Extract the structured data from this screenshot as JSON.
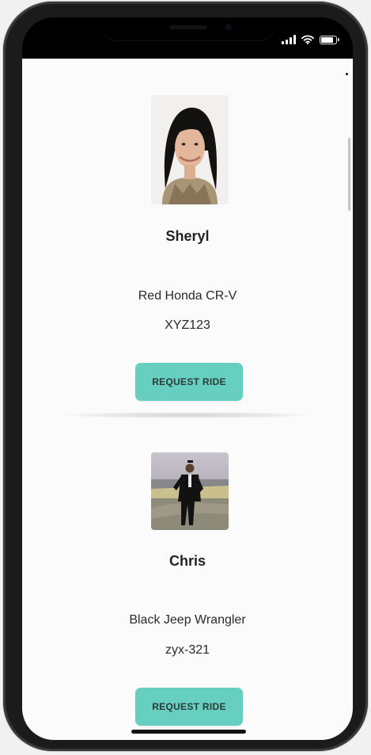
{
  "status_bar": {
    "icons": [
      "signal-icon",
      "wifi-icon",
      "battery-icon"
    ]
  },
  "drivers": [
    {
      "name": "Sheryl",
      "car": "Red Honda CR-V",
      "plate": "XYZ123",
      "button_label": "REQUEST RIDE",
      "photo": "driver-photo"
    },
    {
      "name": "Chris",
      "car": "Black Jeep Wrangler",
      "plate": "zyx-321",
      "button_label": "REQUEST RIDE",
      "photo": "driver-photo"
    }
  ],
  "colors": {
    "accent": "#66cfc0",
    "background": "#fbfbfb"
  }
}
